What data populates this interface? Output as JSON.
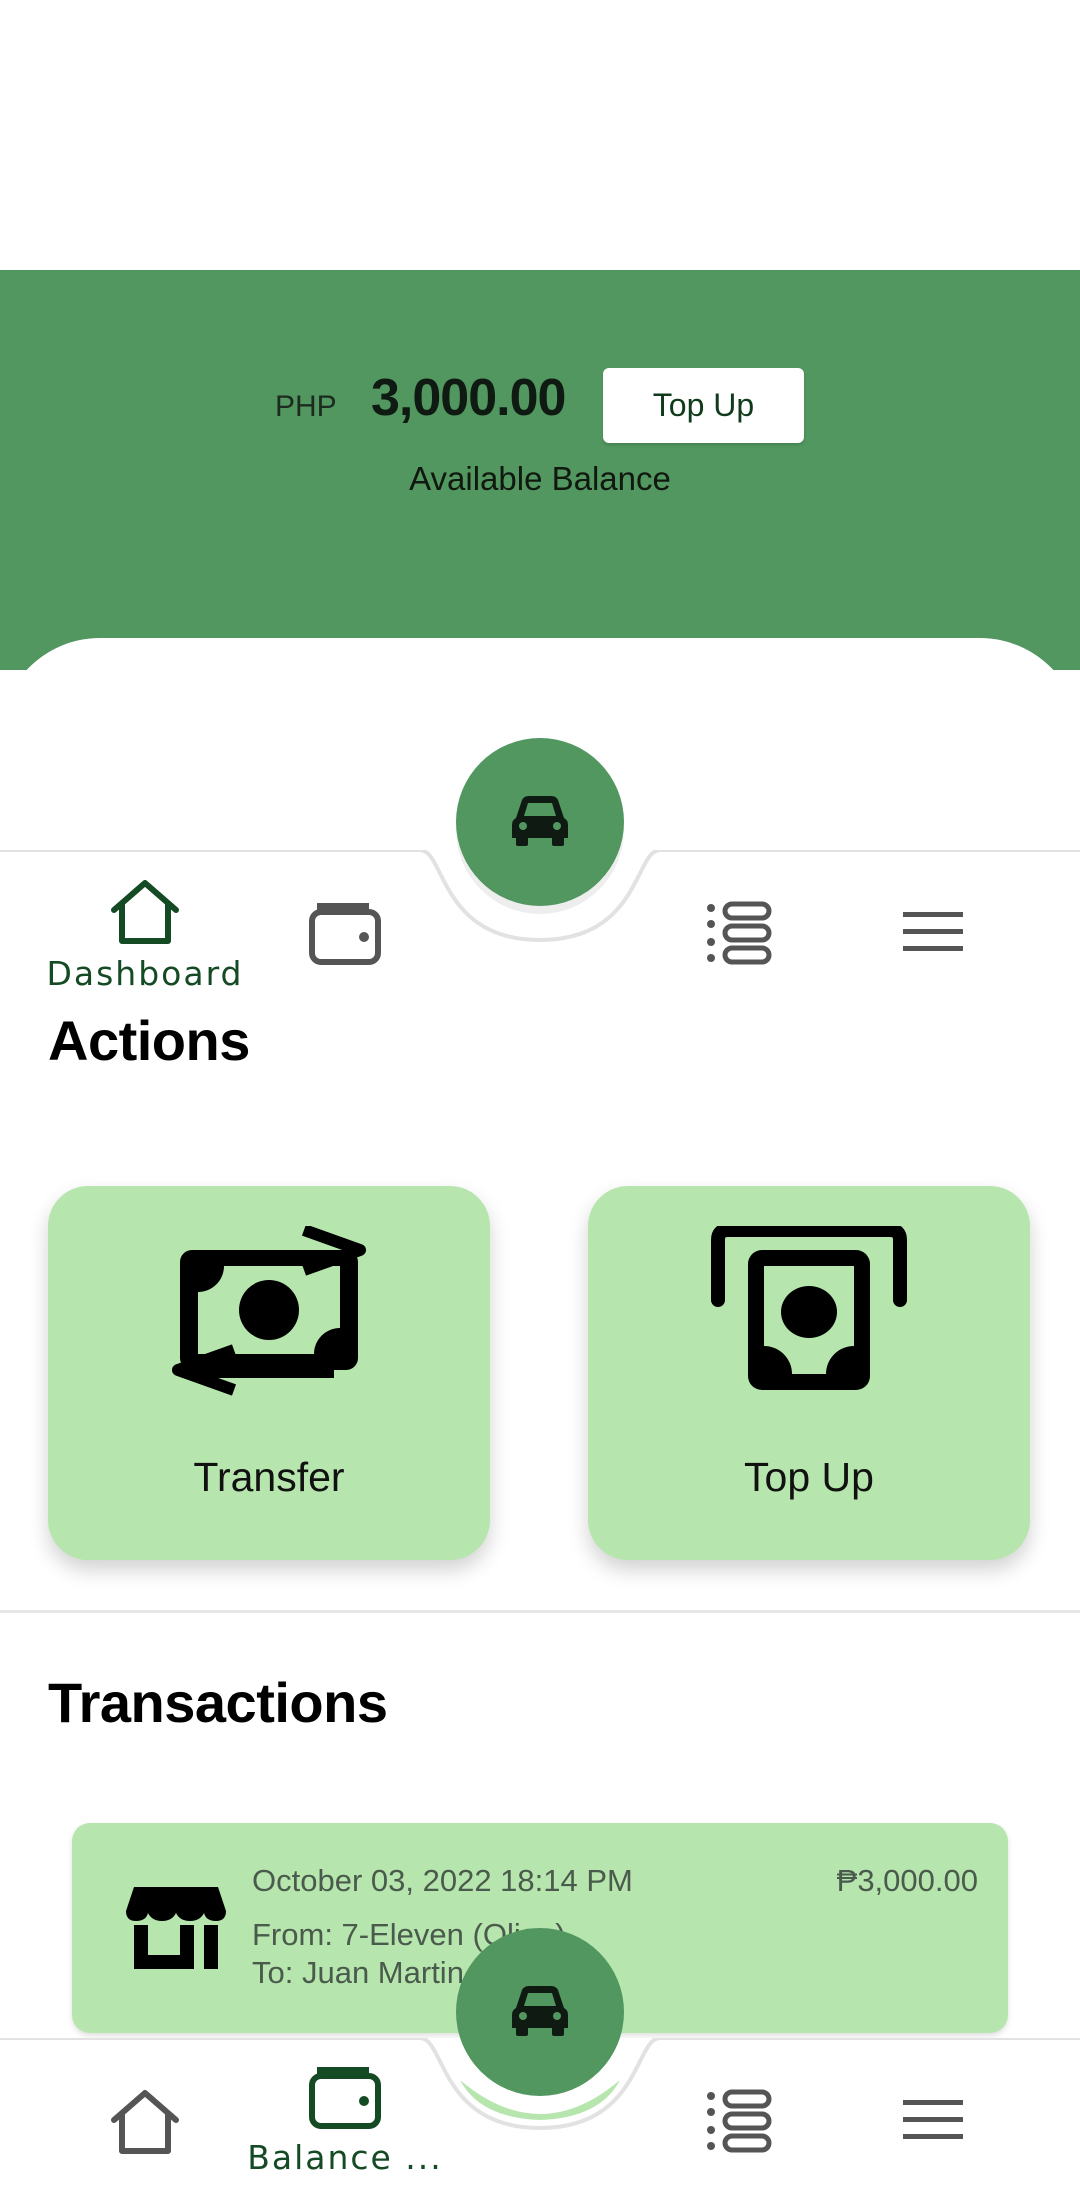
{
  "balance": {
    "currency": "PHP",
    "amount": "3,000.00",
    "topup_label": "Top Up",
    "subtitle": "Available Balance"
  },
  "top_nav": {
    "items": [
      {
        "label": "Dashboard",
        "icon": "home-icon",
        "active": true
      },
      {
        "label": "",
        "icon": "wallet-icon",
        "active": false
      },
      {
        "label": "",
        "icon": "list-icon",
        "active": false
      },
      {
        "label": "",
        "icon": "menu-icon",
        "active": false
      }
    ],
    "fab_icon": "car-icon"
  },
  "actions": {
    "title": "Actions",
    "cards": [
      {
        "label": "Transfer",
        "icon": "money-transfer-icon"
      },
      {
        "label": "Top Up",
        "icon": "cash-withdraw-icon"
      }
    ]
  },
  "transactions": {
    "title": "Transactions",
    "items": [
      {
        "icon": "store-icon",
        "date": "October 03, 2022 18:14 PM",
        "amount": "₱3,000.00",
        "from": "From: 7-Eleven (Oliga)",
        "to": "To: Juan Martin Dela Cruz"
      }
    ]
  },
  "bottom_nav": {
    "items": [
      {
        "label": "",
        "icon": "home-icon",
        "active": false
      },
      {
        "label": "Balance ...",
        "icon": "wallet-icon",
        "active": true
      },
      {
        "label": "",
        "icon": "list-icon",
        "active": false
      },
      {
        "label": "",
        "icon": "menu-icon",
        "active": false
      }
    ],
    "fab_icon": "car-icon"
  },
  "colors": {
    "primary": "#52975f",
    "card": "#b6e6ad",
    "active_nav": "#154b24",
    "inactive_nav": "#555555"
  }
}
